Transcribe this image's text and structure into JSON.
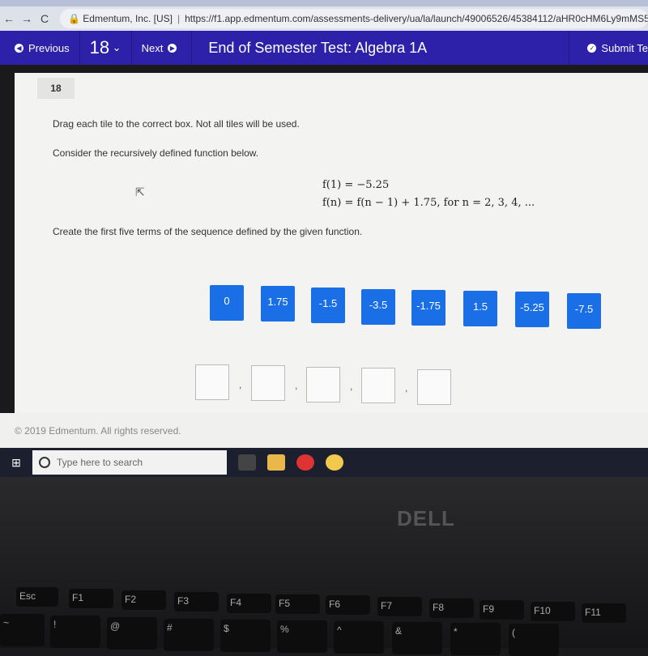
{
  "browser": {
    "back": "←",
    "forward": "→",
    "reload": "C",
    "site": "Edmentum, Inc. [US]",
    "url": "https://f1.app.edmentum.com/assessments-delivery/ua/la/launch/49006526/45384112/aHR0cHM6Ly9mMS5hcH"
  },
  "header": {
    "previous": "Previous",
    "question_number": "18",
    "next": "Next",
    "title": "End of Semester Test: Algebra 1A",
    "submit": "Submit Te"
  },
  "question": {
    "number": "18",
    "instruction": "Drag each tile to the correct box. Not all tiles will be used.",
    "prompt": "Consider the recursively defined function below.",
    "formula1": "f(1) = −5.25",
    "formula2": "f(n) = f(n − 1) + 1.75, for n = 2, 3, 4, ...",
    "task": "Create the first five terms of the sequence defined by the given function.",
    "tiles": [
      "0",
      "1.75",
      "-1.5",
      "-3.5",
      "-1.75",
      "1.5",
      "-5.25",
      "-7.5"
    ],
    "answer_boxes": [
      "",
      "",
      "",
      "",
      ""
    ],
    "separator": ","
  },
  "footer": {
    "copyright": "© 2019 Edmentum. All rights reserved."
  },
  "taskbar": {
    "search_placeholder": "Type here to search"
  },
  "laptop": {
    "brand": "DELL",
    "keys": [
      "Esc",
      "F1",
      "F2",
      "F3",
      "F4",
      "F5",
      "F6",
      "F7",
      "F8",
      "F9",
      "F10",
      "F11"
    ],
    "number_keys": [
      "~",
      "!",
      "@",
      "#",
      "$",
      "%",
      "^",
      "&",
      "*",
      "("
    ]
  },
  "colors": {
    "header": "#2c21a8",
    "tile": "#1a6fe6"
  }
}
